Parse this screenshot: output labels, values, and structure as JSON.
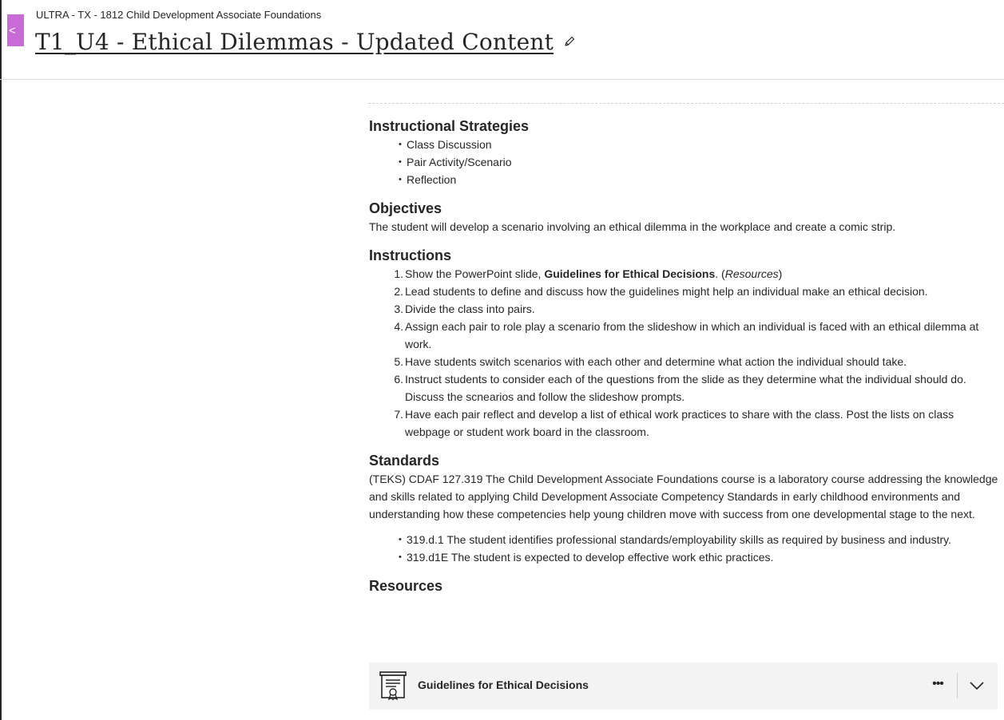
{
  "header": {
    "course_name": "ULTRA - TX - 1812 Child Development Associate Foundations",
    "title": "T1_U4 - Ethical Dilemmas - Updated Content",
    "back_label": "<"
  },
  "sections": {
    "strategies": {
      "heading": "Instructional Strategies",
      "items": [
        "Class Discussion",
        "Pair Activity/Scenario",
        "Reflection"
      ]
    },
    "objectives": {
      "heading": "Objectives",
      "text": "The student will develop a scenario involving an ethical dilemma in the workplace and create a comic strip."
    },
    "instructions": {
      "heading": "Instructions",
      "step1_pre": "Show the PowerPoint slide, ",
      "step1_bold": "Guidelines for Ethical Decisions",
      "step1_mid": ". (",
      "step1_italic": "Resources",
      "step1_post": ")",
      "steps": [
        "Lead students to define and discuss how the guidelines might help an individual make an ethical decision.",
        "Divide the class into pairs.",
        "Assign each pair to role play a scenario from the slideshow in which an individual is faced with an ethical dilemma at work.",
        "Have students switch scenarios with each other and determine what action the individual should take.",
        "Instruct students to consider each of the questions from the slide as they determine what the individual should do. Discuss the scnearios and follow the slideshow prompts.",
        "Have each pair reflect and develop a list of ethical work practices to share with the class. Post the lists on class webpage or student work board in the classroom."
      ],
      "numbers": [
        "1.",
        "2.",
        "3.",
        "4.",
        "5.",
        "6.",
        "7."
      ]
    },
    "standards": {
      "heading": "Standards",
      "text": "(TEKS) CDAF 127.319 The Child Development Associate Foundations course is a laboratory course addressing the knowledge and skills related to applying Child Development Associate Competency Standards in early childhood environments and understanding how these competencies help young children move with success from one developmental stage to the next.",
      "items": [
        "319.d.1 The student identifies professional standards/employability skills as required by business and industry.",
        "319.d1E The student is expected to develop effective work ethic practices."
      ]
    },
    "resources": {
      "heading": "Resources",
      "item_label": "Guidelines for Ethical Decisions",
      "more_label": "•••",
      "item_icon": "document-certificate-icon"
    }
  },
  "colors": {
    "accent": "#c86bd6",
    "text": "#262626",
    "resource_bg": "#f3f3f3"
  }
}
